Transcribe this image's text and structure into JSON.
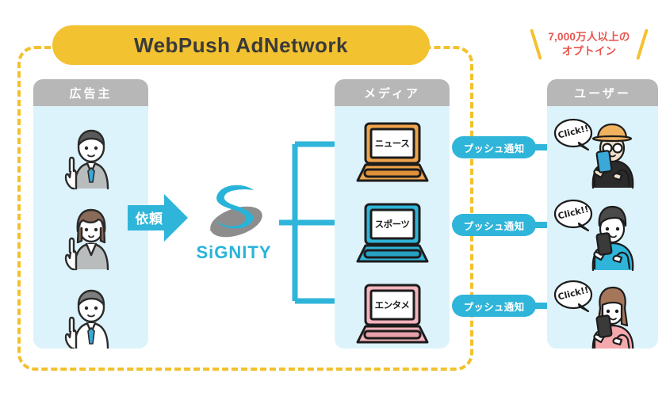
{
  "diagram": {
    "title": "WebPush AdNetwork",
    "callout": {
      "line1": "7,000万人以上の",
      "line2": "オプトイン",
      "color": "#e8554e",
      "accent": "#f2c230"
    },
    "border_color": "#f2c12e",
    "title_bg": "#f2c230",
    "panel_bg": "#ddf3fb",
    "panel_header_bg": "#b7b7b7",
    "accent_cyan": "#2fb5d9"
  },
  "columns": [
    {
      "id": "advertiser",
      "header": "広告主",
      "figures": [
        {
          "name": "businessman-gray-suit",
          "suit": "#b9bcbd",
          "tie": "#3aa8d8",
          "hair": "#5a5a5a"
        },
        {
          "name": "businesswoman-gray-suit",
          "suit": "#b9bcbd",
          "tie": "",
          "hair": "#8a6a58"
        },
        {
          "name": "businessman-white-shirt",
          "suit": "#ffffff",
          "tie": "#3aa8d8",
          "hair": "#7d7d7d"
        }
      ]
    },
    {
      "id": "media",
      "header": "メディア",
      "figures": [
        {
          "name": "laptop-news",
          "label": "ニュース",
          "color": "#f0a44c"
        },
        {
          "name": "laptop-sports",
          "label": "スポーツ",
          "color": "#2fb5d9"
        },
        {
          "name": "laptop-entertainment",
          "label": "エンタメ",
          "color": "#f4b3bd"
        }
      ]
    },
    {
      "id": "user",
      "header": "ユーザー",
      "figures": [
        {
          "name": "user-hat-glasses",
          "bubble": "Click!!",
          "top": "#2b2b2b",
          "hat": "#f0b25e",
          "phone": "#3aa8d8",
          "hair": "#efe0cd"
        },
        {
          "name": "user-teal-shirt",
          "bubble": "Click!!",
          "top": "#2fb5d9",
          "hat": "",
          "phone": "#3a3a3a",
          "hair": "#4a4a4a"
        },
        {
          "name": "user-pink-shirt",
          "bubble": "Click!!",
          "top": "#f4a8ac",
          "hat": "",
          "phone": "#3a3a3a",
          "hair": "#a6765a"
        }
      ]
    }
  ],
  "request_arrow": {
    "label": "依頼",
    "color": "#2fb5d9"
  },
  "logo": {
    "wordmark": "SiGNITY",
    "swoosh_color": "#29b3d8",
    "teardrop_color": "#8d8d8d"
  },
  "push_notifications": [
    {
      "label": "プッシュ通知"
    },
    {
      "label": "プッシュ通知"
    },
    {
      "label": "プッシュ通知"
    }
  ]
}
